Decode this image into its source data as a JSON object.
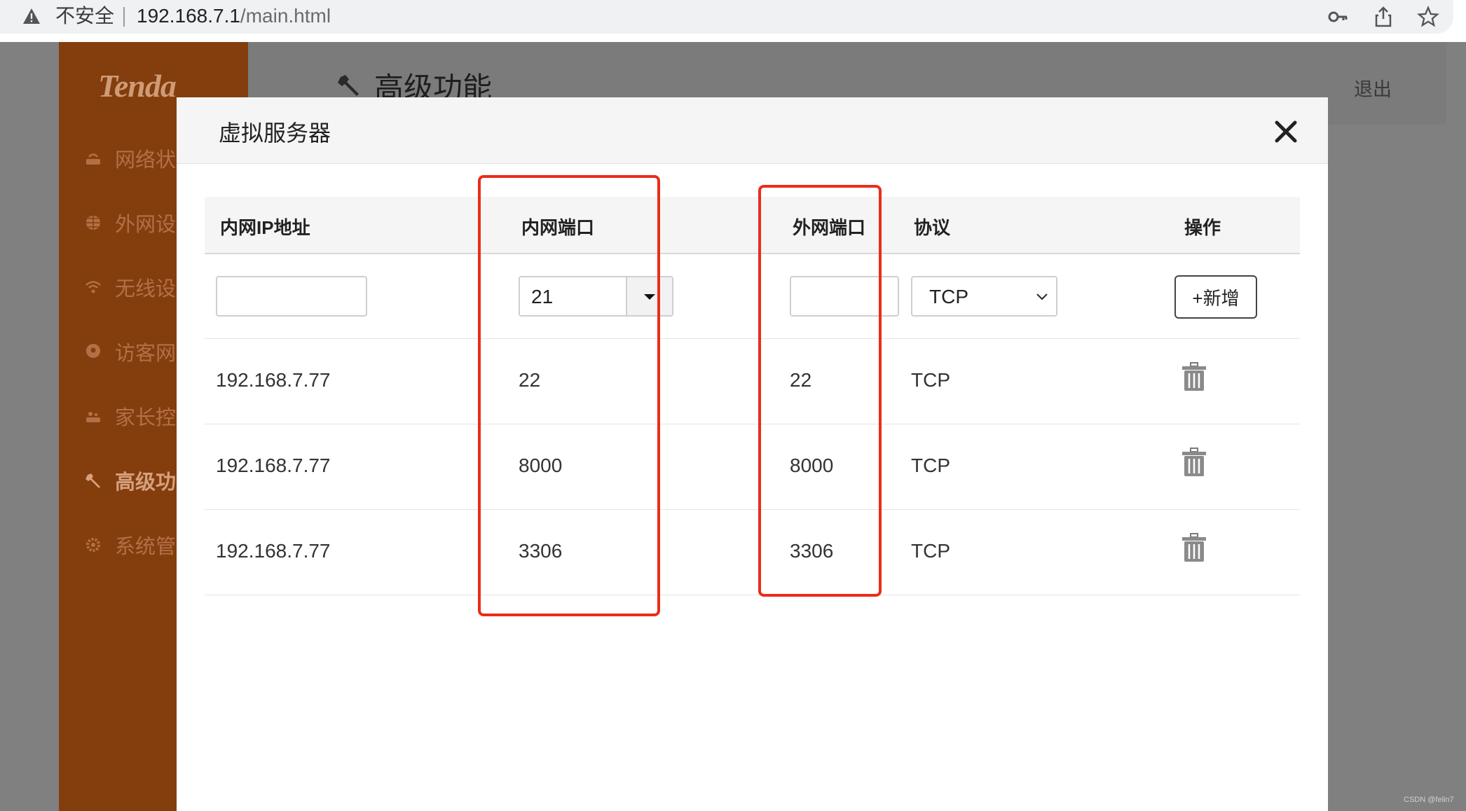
{
  "browser": {
    "security_label": "不安全",
    "url_host": "192.168.7.1",
    "url_path": "/main.html"
  },
  "background_page": {
    "logo": "Tenda",
    "nav": [
      {
        "label": "网络状态",
        "icon": "router-icon",
        "active": false
      },
      {
        "label": "外网设置",
        "icon": "globe-icon",
        "active": false
      },
      {
        "label": "无线设置",
        "icon": "wifi-icon",
        "active": false
      },
      {
        "label": "访客网络",
        "icon": "guest-icon",
        "active": false
      },
      {
        "label": "家长控制",
        "icon": "parental-icon",
        "active": false
      },
      {
        "label": "高级功能",
        "icon": "wrench-icon",
        "active": true
      },
      {
        "label": "系统管理",
        "icon": "gear-icon",
        "active": false
      }
    ],
    "page_title": "高级功能",
    "logout": "退出"
  },
  "modal": {
    "title": "虚拟服务器",
    "columns": {
      "lan_ip": "内网IP地址",
      "lan_port": "内网端口",
      "wan_port": "外网端口",
      "protocol": "协议",
      "action": "操作"
    },
    "form": {
      "lan_ip_value": "",
      "lan_port_value": "21",
      "wan_port_value": "",
      "protocol_value": "TCP",
      "add_label": "+新增"
    },
    "rows": [
      {
        "ip": "192.168.7.77",
        "lan_port": "22",
        "wan_port": "22",
        "protocol": "TCP"
      },
      {
        "ip": "192.168.7.77",
        "lan_port": "8000",
        "wan_port": "8000",
        "protocol": "TCP"
      },
      {
        "ip": "192.168.7.77",
        "lan_port": "3306",
        "wan_port": "3306",
        "protocol": "TCP"
      }
    ]
  },
  "colors": {
    "sidebar": "#843d0d",
    "annotation": "#ea2d1a",
    "overlay": "#808080"
  },
  "watermark": "CSDN @felin7"
}
